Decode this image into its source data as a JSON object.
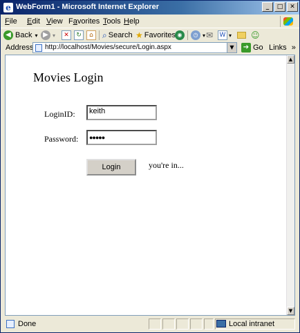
{
  "window": {
    "title": "WebForm1 - Microsoft Internet Explorer",
    "buttons": [
      "_",
      "□",
      "✕"
    ]
  },
  "menu": {
    "items": [
      {
        "accel": "F",
        "rest": "ile"
      },
      {
        "accel": "E",
        "rest": "dit"
      },
      {
        "accel": "V",
        "rest": "iew"
      },
      {
        "accel": "",
        "pre": "F",
        "accel2": "a",
        "rest": "vorites"
      },
      {
        "accel": "T",
        "rest": "ools"
      },
      {
        "accel": "H",
        "rest": "elp"
      }
    ]
  },
  "toolbar": {
    "back_label": "Back",
    "search_label": "Search",
    "favorites_label": "Favorites"
  },
  "address": {
    "label": "Address",
    "url": "http://localhost/Movies/secure/Login.aspx",
    "go_label": "Go",
    "links_label": "Links",
    "links_chevron": "»"
  },
  "page": {
    "heading": "Movies Login",
    "login_id_label": "LoginID:",
    "login_id_value": "keith",
    "password_label": "Password:",
    "password_value": "●●●●●",
    "login_button": "Login",
    "message": "you're in..."
  },
  "status": {
    "text": "Done",
    "zone": "Local intranet"
  },
  "colors": {
    "titlebar": "#0a246a",
    "chrome": "#ece9d8",
    "go_green": "#3a9a2a"
  }
}
